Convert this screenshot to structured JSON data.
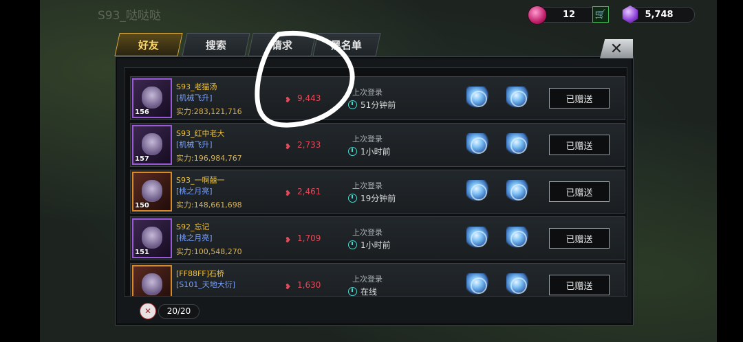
{
  "background": {
    "player_name": "S93_哒哒哒"
  },
  "resources": {
    "gems": "12",
    "crystals": "5,748"
  },
  "tabs": [
    {
      "label": "好友",
      "active": true
    },
    {
      "label": "搜索",
      "active": false
    },
    {
      "label": "请求",
      "active": false
    },
    {
      "label": "黑名单",
      "active": false
    }
  ],
  "friends": [
    {
      "name": "S93_老猫汤",
      "guild": "[机械飞升]",
      "power": "实力:283,121,716",
      "level": "156",
      "score": "9,443",
      "login_label": "上次登录",
      "login_time": "51分钟前",
      "gift_label": "已赠送"
    },
    {
      "name": "S93_红中老大",
      "guild": "[机械飞升]",
      "power": "实力:196,984,767",
      "level": "157",
      "score": "2,733",
      "login_label": "上次登录",
      "login_time": "1小时前",
      "gift_label": "已赠送"
    },
    {
      "name": "S93_一啊囍一",
      "guild": "[桃之月亮]",
      "power": "实力:148,661,698",
      "level": "150",
      "score": "2,461",
      "login_label": "上次登录",
      "login_time": "19分钟前",
      "gift_label": "已赠送"
    },
    {
      "name": "S92_忘记",
      "guild": "[桃之月亮]",
      "power": "实力:100,548,270",
      "level": "151",
      "score": "1,709",
      "login_label": "上次登录",
      "login_time": "1小时前",
      "gift_label": "已赠送"
    },
    {
      "name": "[FF88FF]石桥",
      "guild": "[S101_天地大衍]",
      "power": "",
      "level": "",
      "score": "1,630",
      "login_label": "上次登录",
      "login_time": "在线",
      "gift_label": "已赠送"
    }
  ],
  "footer": {
    "friend_count": "20/20"
  },
  "colors": {
    "accent_gold": "#ffd76a",
    "score_red": "#e34a5a",
    "guild_blue": "#7aa2ff"
  }
}
